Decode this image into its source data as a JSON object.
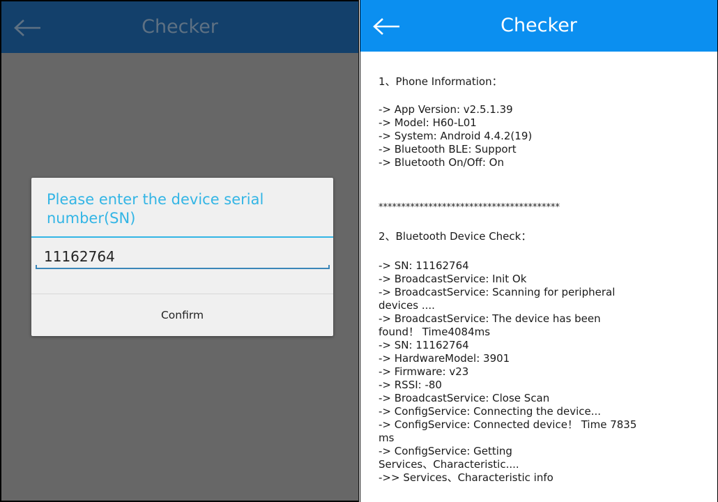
{
  "left_screen": {
    "title": "Checker",
    "dialog": {
      "title": "Please enter the device serial number(SN)",
      "sn_value": "11162764",
      "confirm_label": "Confirm"
    }
  },
  "right_screen": {
    "title": "Checker",
    "section1": {
      "heading": "1、Phone Information：",
      "lines": [
        "-> App Version: v2.5.1.39",
        "-> Model: H60-L01",
        "-> System: Android 4.4.2(19)",
        "-> Bluetooth BLE: Support",
        "-> Bluetooth On/Off: On"
      ]
    },
    "separator": "****************************************",
    "section2": {
      "heading": "2、Bluetooth Device Check：",
      "lines": [
        "-> SN: 11162764",
        "-> BroadcastService: Init Ok",
        "-> BroadcastService: Scanning for peripheral",
        "devices ....",
        "-> BroadcastService: The device has been",
        "found！ Time4084ms",
        "-> SN: 11162764",
        "-> HardwareModel: 3901",
        "-> Firmware: v23",
        "-> RSSI: -80",
        "-> BroadcastService: Close Scan",
        "-> ConfigService: Connecting the device...",
        "-> ConfigService: Connected device！ Time 7835",
        "ms",
        "-> ConfigService: Getting",
        "Services、Characteristic....",
        "->> Services、Characteristic info"
      ]
    }
  },
  "colors": {
    "left_appbar": "#13406b",
    "left_overlay": "#676767",
    "dialog_accent": "#33b5e5",
    "right_appbar": "#0b8ff0"
  },
  "icons": {
    "back": "back-arrow-icon"
  }
}
